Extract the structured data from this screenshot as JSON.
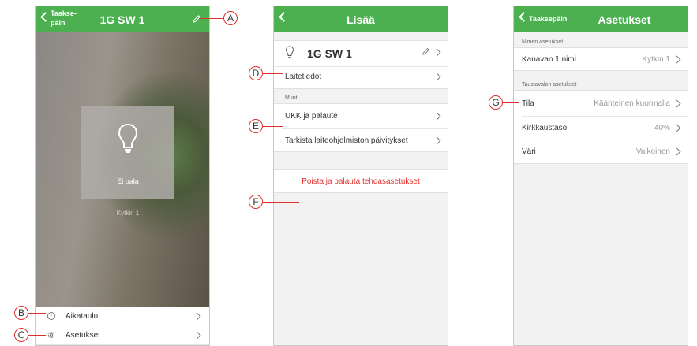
{
  "screen1": {
    "back_label": "Taakse-\npäin",
    "title": "1G SW 1",
    "tile_state": "Ei pala",
    "channel_label": "Kytkin 1",
    "items": [
      {
        "label": "Aikataulu",
        "icon": "clock-icon"
      },
      {
        "label": "Asetukset",
        "icon": "gear-icon"
      }
    ]
  },
  "screen2": {
    "title": "Lisää",
    "device_name": "1G SW 1",
    "device_info": "Laitetiedot",
    "section_other": "Muut",
    "faq": "UKK ja palaute",
    "firmware": "Tarkista laiteohjelmiston päivitykset",
    "reset": "Poista ja palauta tehdasasetukset"
  },
  "screen3": {
    "back_label": "Taaksepäin",
    "title": "Asetukset",
    "section_name": "Nimen asetukset",
    "channel_name_label": "Kanavan 1 nimi",
    "channel_name_value": "Kytkin 1",
    "section_backlight": "Taustavalon asetukset",
    "rows": [
      {
        "label": "Tila",
        "value": "Käänteinen kuormalla"
      },
      {
        "label": "Kirkkaustaso",
        "value": "40%"
      },
      {
        "label": "Väri",
        "value": "Valkoinen"
      }
    ]
  },
  "callouts": [
    "A",
    "B",
    "C",
    "D",
    "E",
    "F",
    "G"
  ],
  "colors": {
    "header": "#4cb050",
    "callout": "#e0302c",
    "reset_text": "#e0302c"
  }
}
